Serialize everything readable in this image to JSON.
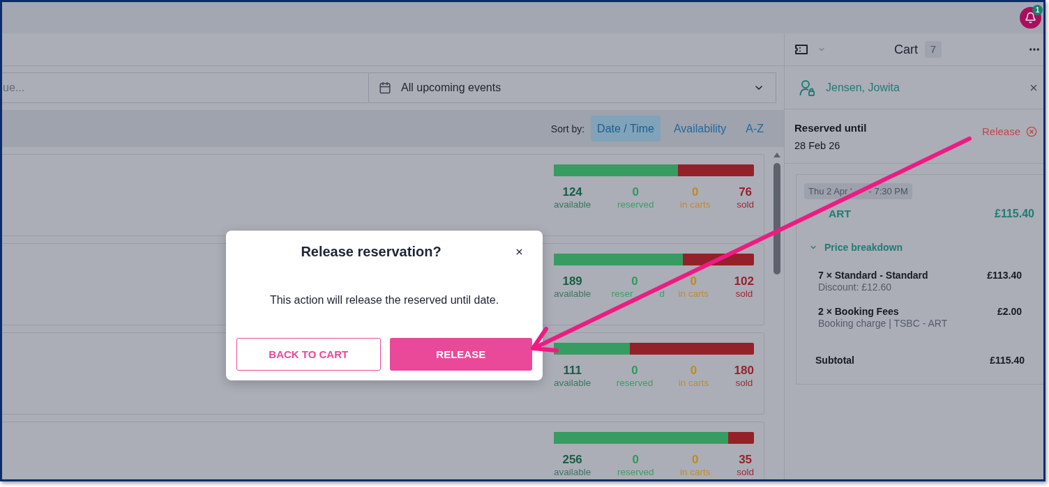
{
  "top_bar": {
    "notification_count": "1"
  },
  "search": {
    "placeholder": "ue..."
  },
  "date_filter": {
    "value": "All upcoming events"
  },
  "sort": {
    "label": "Sort by:",
    "options": [
      {
        "label": "Date / Time",
        "selected": true
      },
      {
        "label": "Availability",
        "selected": false
      },
      {
        "label": "A-Z",
        "selected": false
      }
    ]
  },
  "events": [
    {
      "level": 0.62,
      "stats": [
        {
          "kind": "available",
          "value": "124",
          "label": "available"
        },
        {
          "kind": "reserved",
          "value": "0",
          "label": "reserved"
        },
        {
          "kind": "in_carts",
          "value": "0",
          "label": "in carts"
        },
        {
          "kind": "sold",
          "value": "76",
          "label": "sold"
        }
      ]
    },
    {
      "level": 0.645,
      "stats": [
        {
          "kind": "available",
          "value": "189",
          "label": "available"
        },
        {
          "kind": "reserved",
          "value": "0",
          "label": "reser",
          "label_tail": "d"
        },
        {
          "kind": "in_carts",
          "value": "0",
          "label": "in carts"
        },
        {
          "kind": "sold",
          "value": "102",
          "label": "sold"
        }
      ]
    },
    {
      "level": 0.38,
      "stats": [
        {
          "kind": "available",
          "value": "111",
          "label": "available"
        },
        {
          "kind": "reserved",
          "value": "0",
          "label": "reserved"
        },
        {
          "kind": "in_carts",
          "value": "0",
          "label": "in carts"
        },
        {
          "kind": "sold",
          "value": "180",
          "label": "sold"
        }
      ]
    },
    {
      "level": 0.87,
      "stats": [
        {
          "kind": "available",
          "value": "256",
          "label": "available"
        },
        {
          "kind": "reserved",
          "value": "0",
          "label": "reserved"
        },
        {
          "kind": "in_carts",
          "value": "0",
          "label": "in carts"
        },
        {
          "kind": "sold",
          "value": "35",
          "label": "sold"
        }
      ]
    }
  ],
  "cart": {
    "title": "Cart",
    "count": "7",
    "customer": "Jensen, Jowita",
    "reserved_label": "Reserved until",
    "reserved_date": "28 Feb 26",
    "release_link": "Release",
    "item": {
      "date": "Thu 2 Apr '",
      "date_tail": "- 7:30 PM",
      "title": "ART",
      "price": "£115.40",
      "breakdown_label": "Price breakdown",
      "breakdown_expanded": true,
      "lines": [
        {
          "name": "7 × Standard - Standard",
          "detail": "Discount: £12.60",
          "price": "£113.40"
        },
        {
          "name": "2 × Booking Fees",
          "detail": "Booking charge | TSBC - ART",
          "price": "£2.00"
        }
      ],
      "subtotal_label": "Subtotal",
      "subtotal": "£115.40"
    }
  },
  "dialog": {
    "title": "Release reservation?",
    "message": "This action will release the reserved until date.",
    "buttons": [
      {
        "label": "BACK TO CART",
        "kind": "secondary"
      },
      {
        "label": "RELEASE",
        "kind": "primary"
      }
    ]
  }
}
